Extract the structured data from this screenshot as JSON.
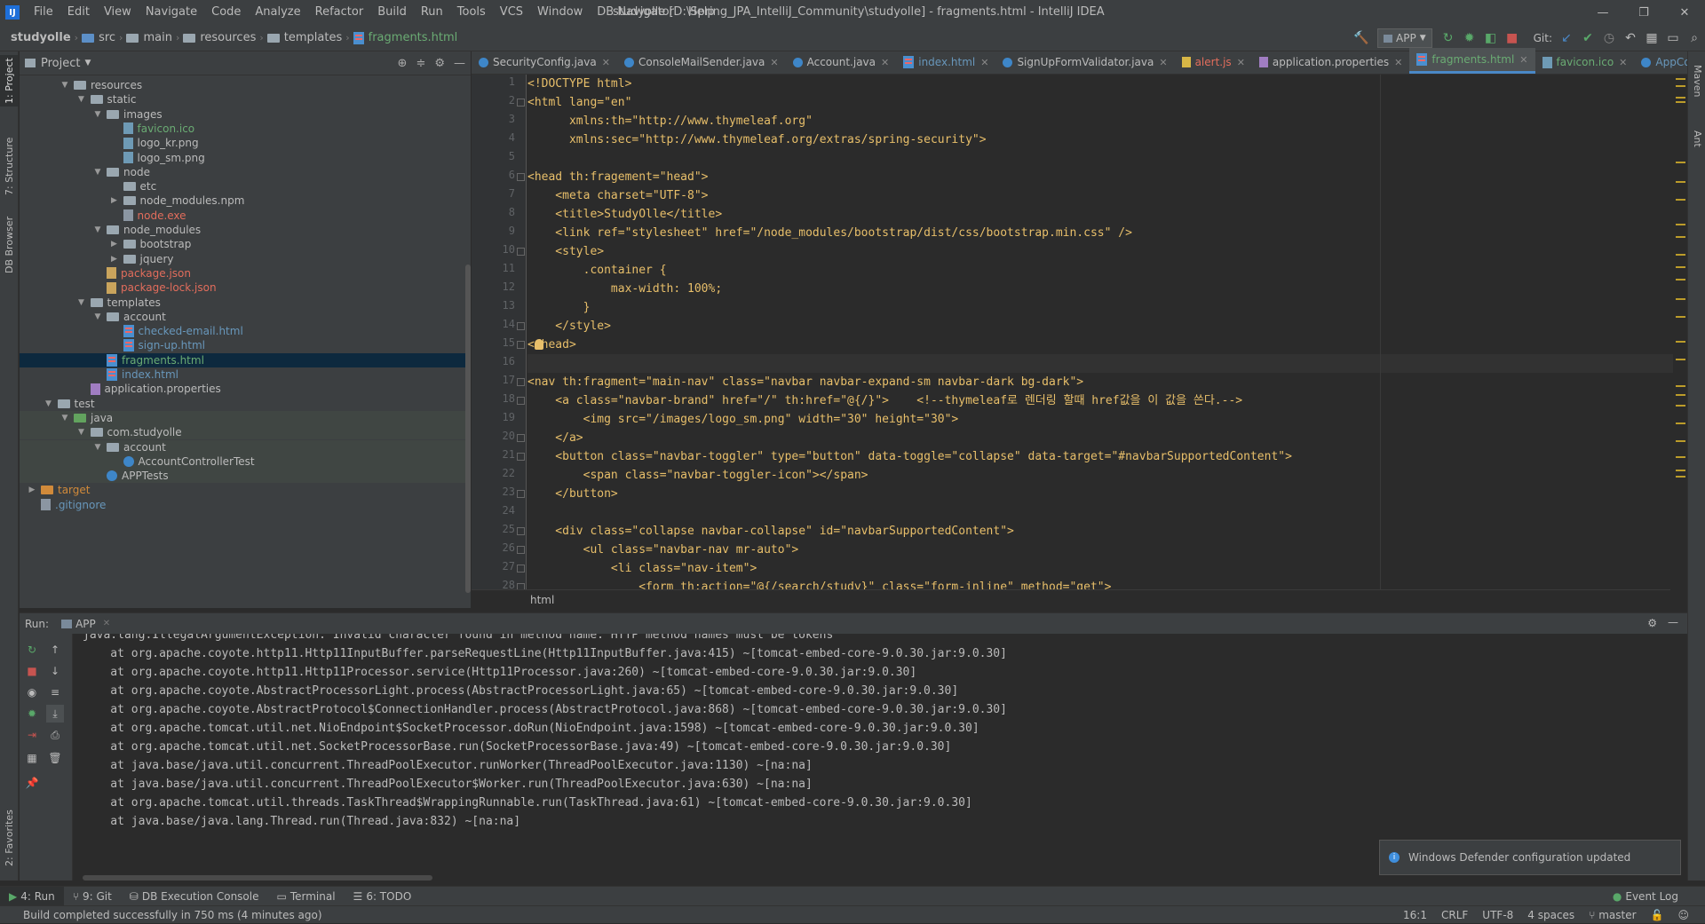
{
  "menubar": {
    "logo": "IJ",
    "items": [
      "File",
      "Edit",
      "View",
      "Navigate",
      "Code",
      "Analyze",
      "Refactor",
      "Build",
      "Run",
      "Tools",
      "VCS",
      "Window",
      "DB Navigator",
      "Help"
    ],
    "title": "studyolle [D:\\Spring_JPA_IntelliJ_Community\\studyolle] - fragments.html - IntelliJ IDEA",
    "minimize": "—",
    "restore": "❐",
    "close": "✕"
  },
  "navbar": {
    "crumbs": [
      "studyolle",
      "src",
      "main",
      "resources",
      "templates",
      "fragments.html"
    ],
    "run_config": "APP",
    "git_label": "Git:"
  },
  "left_strip": {
    "project": "1: Project",
    "structure": "7: Structure",
    "db_browser": "DB Browser",
    "favorites": "2: Favorites"
  },
  "right_strip": {
    "maven": "Maven",
    "ant": "Ant"
  },
  "project": {
    "header": "Project",
    "tree": [
      {
        "label": "resources",
        "depth": 3,
        "kind": "folder",
        "open": true
      },
      {
        "label": "static",
        "depth": 4,
        "kind": "folder",
        "open": true
      },
      {
        "label": "images",
        "depth": 5,
        "kind": "folder",
        "open": true
      },
      {
        "label": "favicon.ico",
        "depth": 6,
        "kind": "img",
        "color": "green"
      },
      {
        "label": "logo_kr.png",
        "depth": 6,
        "kind": "img"
      },
      {
        "label": "logo_sm.png",
        "depth": 6,
        "kind": "img"
      },
      {
        "label": "node",
        "depth": 5,
        "kind": "folder",
        "open": true
      },
      {
        "label": "etc",
        "depth": 6,
        "kind": "folder"
      },
      {
        "label": "node_modules.npm",
        "depth": 6,
        "kind": "folder",
        "closed": true
      },
      {
        "label": "node.exe",
        "depth": 6,
        "kind": "file",
        "color": "red"
      },
      {
        "label": "node_modules",
        "depth": 5,
        "kind": "folder",
        "open": true
      },
      {
        "label": "bootstrap",
        "depth": 6,
        "kind": "folder",
        "closed": true
      },
      {
        "label": "jquery",
        "depth": 6,
        "kind": "folder",
        "closed": true
      },
      {
        "label": "package.json",
        "depth": 5,
        "kind": "json",
        "color": "red"
      },
      {
        "label": "package-lock.json",
        "depth": 5,
        "kind": "json",
        "color": "red"
      },
      {
        "label": "templates",
        "depth": 4,
        "kind": "folder",
        "open": true
      },
      {
        "label": "account",
        "depth": 5,
        "kind": "folder",
        "open": true
      },
      {
        "label": "checked-email.html",
        "depth": 6,
        "kind": "html",
        "color": "blue"
      },
      {
        "label": "sign-up.html",
        "depth": 6,
        "kind": "html",
        "color": "blue"
      },
      {
        "label": "fragments.html",
        "depth": 5,
        "kind": "html",
        "color": "green",
        "selected": true
      },
      {
        "label": "index.html",
        "depth": 5,
        "kind": "html",
        "color": "blue"
      },
      {
        "label": "application.properties",
        "depth": 4,
        "kind": "props"
      },
      {
        "label": "test",
        "depth": 2,
        "kind": "folder",
        "open": true
      },
      {
        "label": "java",
        "depth": 3,
        "kind": "folder",
        "open": true,
        "green": true,
        "testbg": true
      },
      {
        "label": "com.studyolle",
        "depth": 4,
        "kind": "folder",
        "open": true,
        "testbg": true
      },
      {
        "label": "account",
        "depth": 5,
        "kind": "folder",
        "open": true,
        "testbg": true
      },
      {
        "label": "AccountControllerTest",
        "depth": 6,
        "kind": "class",
        "testbg": true
      },
      {
        "label": "APPTests",
        "depth": 5,
        "kind": "class",
        "testbg": true
      },
      {
        "label": "target",
        "depth": 1,
        "kind": "folder",
        "closed": true,
        "color": "orange",
        "orange": true
      },
      {
        "label": ".gitignore",
        "depth": 1,
        "kind": "file",
        "color": "blue"
      }
    ]
  },
  "editor": {
    "tabs": [
      {
        "label": "SecurityConfig.java",
        "icon": "java"
      },
      {
        "label": "ConsoleMailSender.java",
        "icon": "java"
      },
      {
        "label": "Account.java",
        "icon": "java"
      },
      {
        "label": "index.html",
        "icon": "html",
        "color": "blue"
      },
      {
        "label": "SignUpFormValidator.java",
        "icon": "java"
      },
      {
        "label": "alert.js",
        "icon": "js",
        "color": "red"
      },
      {
        "label": "application.properties",
        "icon": "props"
      },
      {
        "label": "fragments.html",
        "icon": "html",
        "color": "green",
        "active": true
      },
      {
        "label": "favicon.ico",
        "icon": "img",
        "color": "green"
      },
      {
        "label": "AppConfig.java",
        "icon": "java",
        "color": "blue"
      }
    ],
    "line_numbers": [
      "1",
      "2",
      "3",
      "4",
      "5",
      "6",
      "7",
      "8",
      "9",
      "10",
      "11",
      "12",
      "13",
      "14",
      "15",
      "16",
      "17",
      "18",
      "19",
      "20",
      "21",
      "22",
      "23",
      "24",
      "25",
      "26",
      "27",
      "28"
    ],
    "breadcrumb": "html",
    "lines": [
      "<!DOCTYPE html>",
      "<html lang=\"en\"",
      "      xmlns:th=\"http://www.thymeleaf.org\"",
      "      xmlns:sec=\"http://www.thymeleaf.org/extras/spring-security\">",
      "",
      "<head th:fragement=\"head\">",
      "    <meta charset=\"UTF-8\">",
      "    <title>StudyOlle</title>",
      "    <link ref=\"stylesheet\" href=\"/node_modules/bootstrap/dist/css/bootstrap.min.css\" />",
      "    <style>",
      "        .container {",
      "            max-width: 100%;",
      "        }",
      "    </style>",
      "</head>",
      "",
      "<nav th:fragment=\"main-nav\" class=\"navbar navbar-expand-sm navbar-dark bg-dark\">",
      "    <a class=\"navbar-brand\" href=\"/\" th:href=\"@{/}\">    <!--thymeleaf로 렌더링 할때 href값을 이 값을 쓴다.-->",
      "        <img src=\"/images/logo_sm.png\" width=\"30\" height=\"30\">",
      "    </a>",
      "    <button class=\"navbar-toggler\" type=\"button\" data-toggle=\"collapse\" data-target=\"#navbarSupportedContent\">",
      "        <span class=\"navbar-toggler-icon\"></span>",
      "    </button>",
      "",
      "    <div class=\"collapse navbar-collapse\" id=\"navbarSupportedContent\">",
      "        <ul class=\"navbar-nav mr-auto\">",
      "            <li class=\"nav-item\">",
      "                <form th:action=\"@{/search/study}\" class=\"form-inline\" method=\"get\">"
    ]
  },
  "run": {
    "label": "Run:",
    "tab": "APP",
    "console": [
      "java.lang.IllegalArgumentException: Invalid character found in method name. HTTP method names must be tokens",
      "    at org.apache.coyote.http11.Http11InputBuffer.parseRequestLine(Http11InputBuffer.java:415) ~[tomcat-embed-core-9.0.30.jar:9.0.30]",
      "    at org.apache.coyote.http11.Http11Processor.service(Http11Processor.java:260) ~[tomcat-embed-core-9.0.30.jar:9.0.30]",
      "    at org.apache.coyote.AbstractProcessorLight.process(AbstractProcessorLight.java:65) ~[tomcat-embed-core-9.0.30.jar:9.0.30]",
      "    at org.apache.coyote.AbstractProtocol$ConnectionHandler.process(AbstractProtocol.java:868) ~[tomcat-embed-core-9.0.30.jar:9.0.30]",
      "    at org.apache.tomcat.util.net.NioEndpoint$SocketProcessor.doRun(NioEndpoint.java:1598) ~[tomcat-embed-core-9.0.30.jar:9.0.30]",
      "    at org.apache.tomcat.util.net.SocketProcessorBase.run(SocketProcessorBase.java:49) ~[tomcat-embed-core-9.0.30.jar:9.0.30]",
      "    at java.base/java.util.concurrent.ThreadPoolExecutor.runWorker(ThreadPoolExecutor.java:1130) ~[na:na]",
      "    at java.base/java.util.concurrent.ThreadPoolExecutor$Worker.run(ThreadPoolExecutor.java:630) ~[na:na]",
      "    at org.apache.tomcat.util.threads.TaskThread$WrappingRunnable.run(TaskThread.java:61) ~[tomcat-embed-core-9.0.30.jar:9.0.30]",
      "    at java.base/java.lang.Thread.run(Thread.java:832) ~[na:na]"
    ],
    "notification": "Windows Defender configuration updated"
  },
  "bottom_tabs": [
    "4: Run",
    "9: Git",
    "DB Execution Console",
    "Terminal",
    "6: TODO"
  ],
  "event_log": "Event Log",
  "status": {
    "message": "Build completed successfully in 750 ms (4 minutes ago)",
    "position": "16:1",
    "line_sep": "CRLF",
    "encoding": "UTF-8",
    "indent": "4 spaces",
    "branch": "master"
  },
  "colors": {
    "accent": "#4a88c7",
    "selection": "#0d293e",
    "panel": "#3c3f41",
    "editor": "#2b2b2b"
  }
}
